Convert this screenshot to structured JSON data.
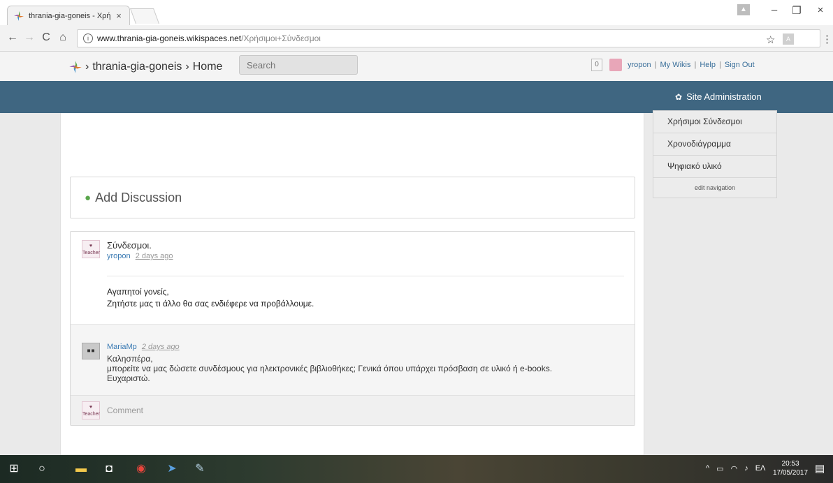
{
  "browser": {
    "tab_title": "thrania-gia-goneis - Χρή",
    "tab_close": "×",
    "url_host": "www.thrania-gia-goneis.wikispaces.net",
    "url_path": "/Χρήσιμοι+Σύνδεσμοι",
    "info_glyph": "i",
    "back_glyph": "←",
    "forward_glyph": "→",
    "reload_glyph": "C",
    "home_glyph": "⌂",
    "star_glyph": "☆",
    "menu_glyph": "⋮",
    "minimize_glyph": "–",
    "restore_glyph": "❐",
    "close_glyph": "×"
  },
  "header": {
    "site": "thrania-gia-goneis",
    "page": "Home",
    "sep": "›",
    "search_placeholder": "Search",
    "notif_count": "0",
    "username": "yropon",
    "my_wikis": "My Wikis",
    "help": "Help",
    "sign_out": "Sign Out",
    "pipe": "|"
  },
  "admin": {
    "label": "Site Administration"
  },
  "navigation": {
    "items": [
      "Χρήσιμοι Σύνδεσμοι",
      "Χρονοδιάγραμμα",
      "Ψηφιακό υλικό"
    ],
    "edit_label": "edit navigation"
  },
  "discussion": {
    "add_label": "Add Discussion",
    "post": {
      "title": "Σύνδεσμοι.",
      "author": "yropon",
      "time": "2 days ago",
      "body_line1": "Αγαπητοί γονείς,",
      "body_line2": "Ζητήστε μας τι άλλο θα σας ενδιέφερε να προβάλλουμε."
    },
    "reply": {
      "author": "MariaMp",
      "time": "2 days ago",
      "line1": "Καλησπέρα,",
      "line2": "μπορείτε να μας δώσετε συνδέσμους για ηλεκτρονικές βιβλιοθήκες; Γενικά όπου υπάρχει πρόσβαση σε υλικό ή e-books.",
      "line3": "Ευχαριστώ."
    },
    "comment_placeholder": "Comment",
    "avatar_text": "Teacher"
  },
  "taskbar": {
    "language": "ΕΛ",
    "time": "20:53",
    "date": "17/05/2017"
  },
  "colors": {
    "admin_bar": "#3f6681",
    "link": "#3a7ab3",
    "discussion_icon": "#5aa64c"
  }
}
